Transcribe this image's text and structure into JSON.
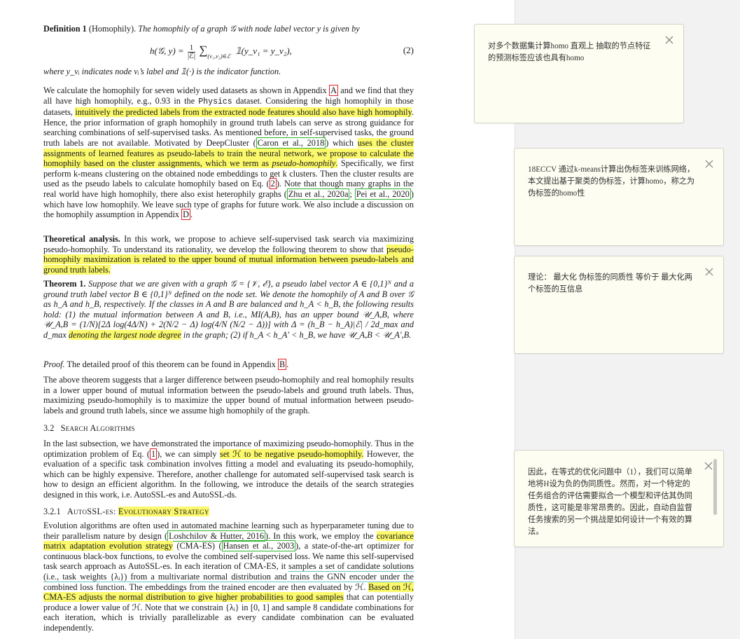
{
  "paper": {
    "def": {
      "label": "Definition 1",
      "name": "(Homophily).",
      "text": "The homophily of a graph 𝒢 with node label vector y is given by"
    },
    "eq2": {
      "lhs": "h(𝒢, y) =",
      "frac_num": "1",
      "frac_den": "|ℰ|",
      "sum": "∑",
      "sub": "(v₁,v₂)∈ℰ",
      "rhs": "𝟙(y_v₁ = y_v₂),",
      "num": "(2)"
    },
    "def_tail": "where y_vᵢ indicates node vᵢ’s label and 𝟙(·) is the indicator function.",
    "p1": {
      "a": "We calculate the homophily for seven widely used datasets as shown in Appendix ",
      "ref_a": "A",
      "b": " and we find that they all have high homophily, e.g., 0.93 in the ",
      "physics": "Physics",
      "c": " dataset. Considering the high homophily in those datasets, ",
      "hl1": "intuitively the predicted labels from the extracted node features should also have high homophily",
      "d": ". Hence, the prior information of graph homophily in ground truth labels can serve as strong guidance for searching combinations of self-supervised tasks. As mentioned before, in self-supervised tasks, the ground truth labels are not available. Motivated by DeepCluster (",
      "ref_caron": "Caron et al., 2018",
      "e": ") which ",
      "hl2": "uses the cluster assignments of learned features as pseudo-labels to train the neural network, we propose to calculate the homophily based on the cluster assignments, which we term as ",
      "hl2_it": "pseudo-homophily",
      "hl2_end": ".",
      "f": " Specifically, we first perform k-means clustering on the obtained node embeddings to get k clusters. Then the cluster results are used as the pseudo labels to calculate homophily based on Eq. (",
      "ref_eq": "2",
      "g": "). Note that though many graphs in the real world have high homophily, there also exist heterophily graphs (",
      "ref_zhu": "Zhu et al., 2020a",
      "semi": "; ",
      "ref_pei": "Pei et al., 2020",
      "h": ") which have low homophily. We leave such type of graphs for future work. We also include a discussion on the homophily assumption in Appendix ",
      "ref_d": "D",
      "i": "."
    },
    "p2": {
      "bold": "Theoretical analysis.",
      "a": " In this work, we propose to achieve self-supervised task search via maximizing pseudo-homophily. To understand its rationality, we develop the following theorem to show that ",
      "hl": "pseudo-homophily maximization is related to the upper bound of mutual information between pseudo-labels and ground truth labels."
    },
    "thm": {
      "bold": "Theorem 1.",
      "a": " Suppose that we are given with a graph 𝒢 = {𝒱, ℰ}, a pseudo label vector A ∈ {0,1}ᴺ and a ground truth label vector B ∈ {0,1}ᴺ defined on the node set. We denote the homophily of A and B over 𝒢 as h_A and h_B, respectively. If the classes in A and B are balanced and h_A < h_B, the following results hold: (1) the mutual information between A and B, i.e., MI(A,B), has an upper bound 𝒰_A,B, where 𝒰_A,B = (1/N)[2Δ log(4Δ/N) + 2(N/2 − Δ) log(4/N (N/2 − Δ))] with Δ = (h_B − h_A)|ℰ| / 2d_max and d_max ",
      "hl": "denoting the largest node degree",
      "b": " in the graph; (2) if h_A < h_A′ < h_B, we have 𝒰_A,B < 𝒰_A′,B."
    },
    "proof": {
      "label": "Proof.",
      "a": " The detailed proof of this theorem can be found in Appendix ",
      "ref_b": "B",
      "b": "."
    },
    "p3": "The above theorem suggests that a larger difference between pseudo-homophily and real homophily results in a lower upper bound of mutual information between the pseudo-labels and ground truth labels. Thus, maximizing pseudo-homophily is to maximize the upper bound of mutual information between pseudo-labels and ground truth labels, since we assume high homophily of the graph.",
    "sec32": {
      "num": "3.2",
      "title": "Search Algorithms"
    },
    "p4": {
      "a": "In the last subsection, we have demonstrated the importance of maximizing pseudo-homophily. Thus in the optimization problem of Eq. (",
      "ref_1": "1",
      "b": "), we can simply ",
      "hl": "set ℋ to be negative pseudo-homophily.",
      "c": " However, the evaluation of a specific task combination involves fitting a model and evaluating its pseudo-homophily, which can be highly expensive. Therefore, another challenge for automated self-supervised task search is how to design an efficient algorithm. In the following, we introduce the details of the search strategies designed in this work, i.e. AutoSSL-es and AutoSSL-ds."
    },
    "sec321": {
      "num": "3.2.1",
      "title_a": "AutoSSL-es: ",
      "title_hl": "Evolutionary Strategy"
    },
    "p5": {
      "a": "Evolution algorithms are often used in automated machine learning such as hyperparameter tuning due to their parallelism nature by design (",
      "ref_losh": "Loshchilov & Hutter, 2016",
      "b": "). In this work, we employ the ",
      "hl1": "covariance matrix adaptation evolution strategy",
      "c": " (CMA-ES) (",
      "ref_hansen": "Hansen et al., 2003",
      "d": "), a state-of-the-art optimizer for continuous black-box functions, to evolve the combined self-supervised loss. We name this self-supervised task search approach as AutoSSL-es. In each iteration of CMA-ES, it ",
      "teal": "samples a set of candidate solutions (i.e., task weights {λᵢ}) from a multivariate normal distribution and trains the GNN encoder under the combined loss function.",
      "e": " The embeddings from the trained encoder are then evaluated by ℋ. ",
      "hl2": "Based on ℋ, CMA-ES adjusts the normal distribution to give higher probabilities to good samples",
      "f": " that can potentially produce a lower value of ℋ. Note that we constrain {λᵢ} in [0, 1] and sample 8 candidate combinations for each iteration, which is trivially parallelizable as every candidate combination can be evaluated independently."
    }
  },
  "notes": [
    {
      "text": "对多个数据集计算homo 直观上 抽取的节点特征的预测标签应该也具有homo"
    },
    {
      "text": "18ECCV 通过k-means计算出伪标签来训练网络， 本文提出基于聚类的伪标签，计算homo，称之为 伪标签的homo性"
    },
    {
      "text": "理论： 最大化 伪标签的同质性 等价于 最大化两个标签的互信息"
    },
    {
      "text": "因此，在等式的优化问题中（1），我们可以简单地将H设为负的伪同质性。然而，对一个特定的任务组合的评估需要拟合一个模型和评估其伪同质性，这可能是非常昂贵的。因此，自动自监督任务搜索的另一个挑战是如何设计一个有效的算法。"
    }
  ],
  "colors": {
    "highlight": "#fbf96b",
    "teal_underline": "#67c3c0",
    "ref_green": "#2fb42f",
    "ref_red": "#e2222a",
    "note_bg": "#fefdf1",
    "panel_bg": "#f2f2f2"
  },
  "icons": {
    "note_close": "close-icon"
  }
}
